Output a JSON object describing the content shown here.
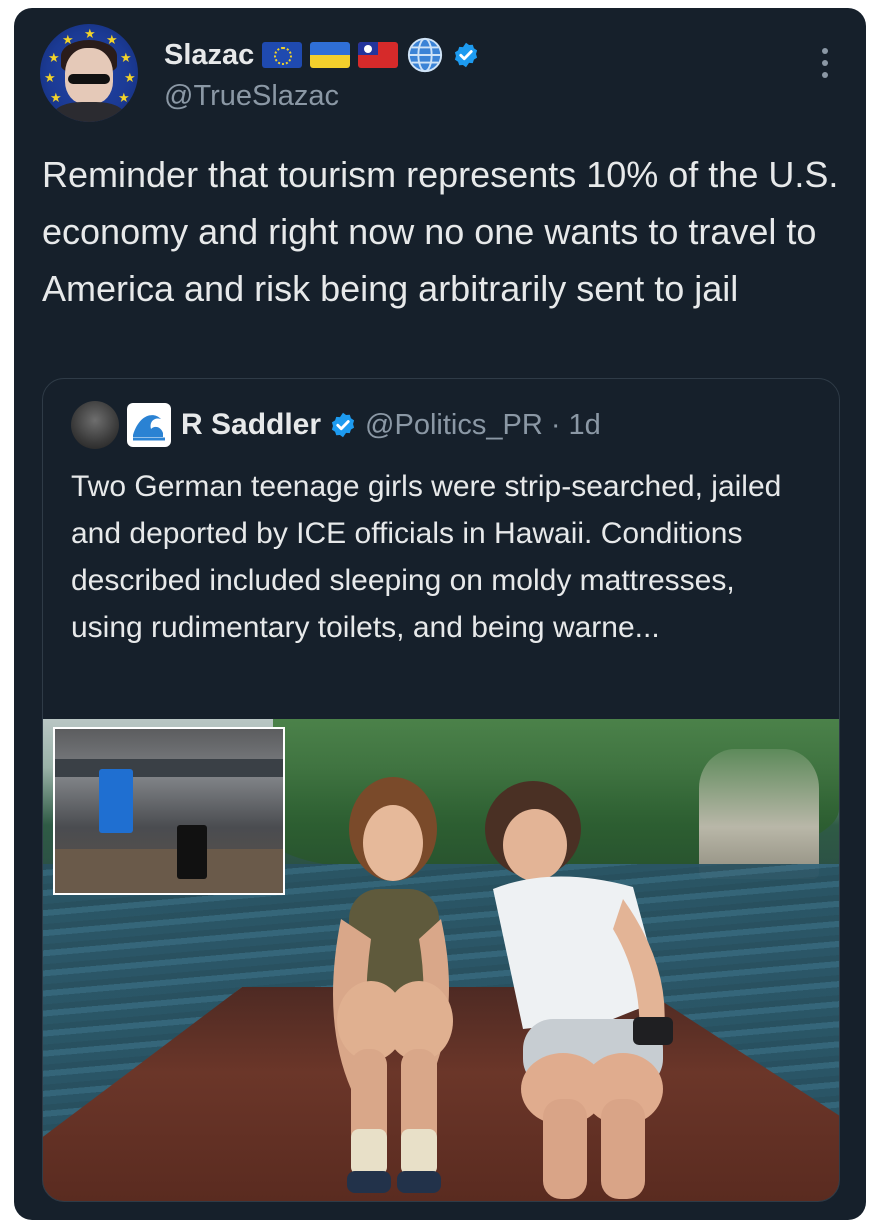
{
  "author": {
    "display_name": "Slazac",
    "handle": "@TrueSlazac",
    "flags": [
      "eu-flag",
      "ukraine-flag",
      "taiwan-flag",
      "globe-icon"
    ],
    "verified": true
  },
  "tweet": {
    "text": "Reminder that tourism represents 10% of the U.S. economy and right now no one wants to travel to America and risk being arbitrarily sent to jail"
  },
  "quoted": {
    "display_name": "R Saddler",
    "handle_time": "@Politics_PR · 1d",
    "verified": true,
    "text": "Two German teenage girls were strip-searched, jailed and deported by ICE officials in Hawaii. Conditions described included sleeping on moldy mattresses, using rudimentary toilets, and being warne..."
  },
  "colors": {
    "background": "#16202b",
    "text": "#e7e9ea",
    "muted": "#8b98a5",
    "verified": "#1d9bf0"
  }
}
